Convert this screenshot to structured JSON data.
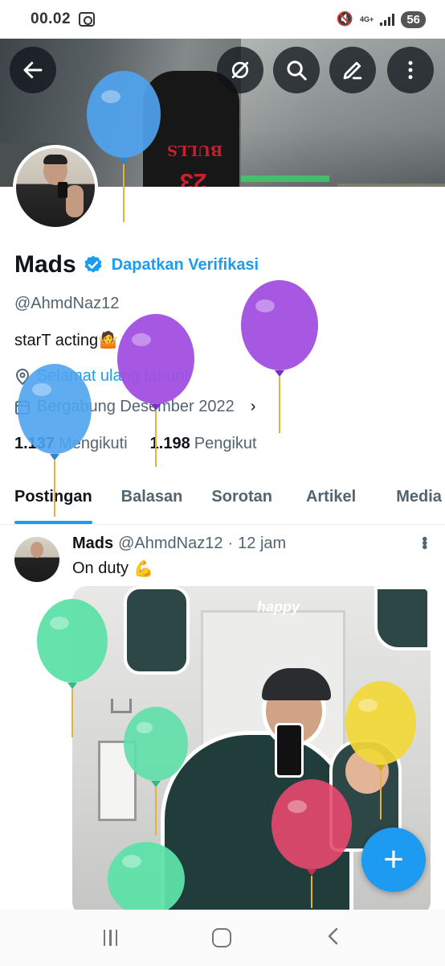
{
  "status_bar": {
    "time": "00.02",
    "network": "4G+",
    "battery": "56"
  },
  "profile": {
    "name": "Mads",
    "get_verified": "Dapatkan Verifikasi",
    "handle": "@AhmdNaz12",
    "bio": "starT acting🤷",
    "birthday": "Selamat ulang tahun!",
    "joined": "Bergabung Desember 2022",
    "following_count": "1.137",
    "following_label": "Mengikuti",
    "followers_count": "1.198",
    "followers_label": "Pengikut"
  },
  "tabs": [
    {
      "label": "Postingan"
    },
    {
      "label": "Balasan"
    },
    {
      "label": "Sorotan"
    },
    {
      "label": "Artikel"
    },
    {
      "label": "Media"
    }
  ],
  "post": {
    "author": "Mads",
    "handle": "@AhmdNaz12",
    "time": "12 jam",
    "text": "On duty",
    "emoji": "💪",
    "media_sticker_text": "happy"
  },
  "colors": {
    "accent": "#1d9bf0",
    "balloon_blue": "#4fa3ef",
    "balloon_purple": "#a24fe0",
    "balloon_green": "#5ee0a8",
    "balloon_yellow": "#f2d837",
    "balloon_pink": "#e8486e"
  },
  "icons": [
    "back-arrow-icon",
    "rocket-off-icon",
    "search-icon",
    "edit-pencil-icon",
    "more-vertical-icon",
    "verified-badge-icon",
    "balloon-icon",
    "location-pin-icon",
    "calendar-icon",
    "plus-icon"
  ]
}
